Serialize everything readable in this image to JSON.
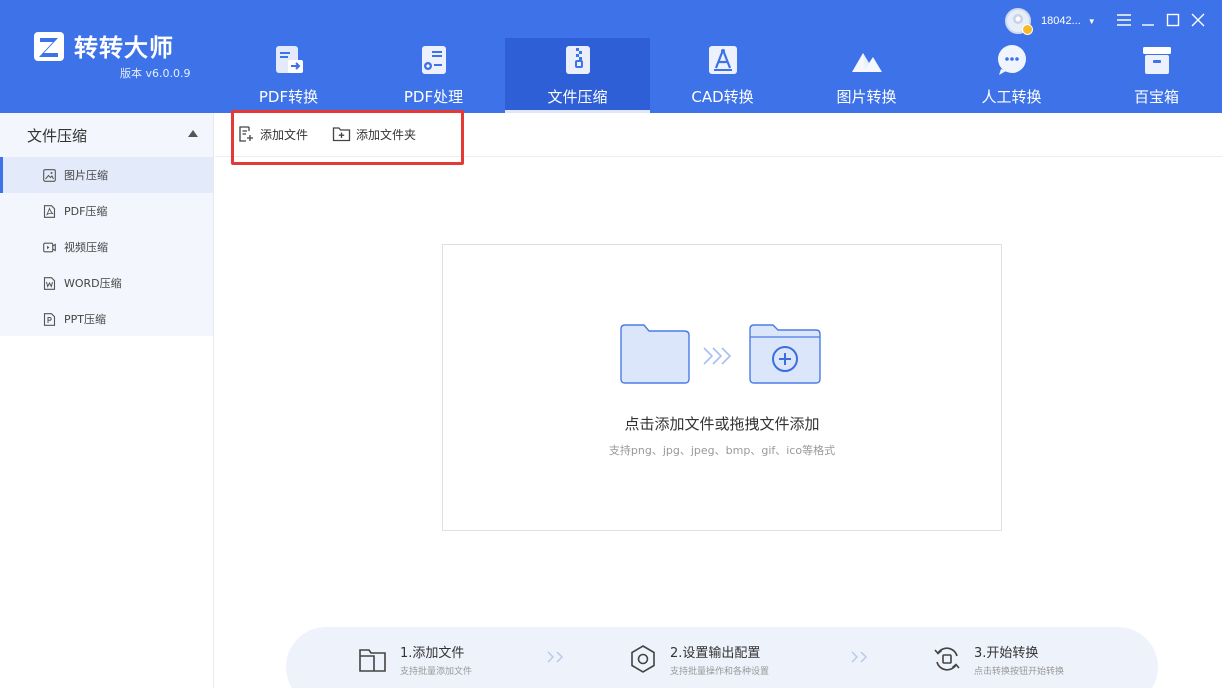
{
  "app": {
    "name": "转转大师",
    "version": "版本 v6.0.0.9",
    "accent_color": "#3d72e8",
    "logo_letter": "Z"
  },
  "user": {
    "name": "18042...",
    "avatar_icon": "user-avatar-icon"
  },
  "window_controls": [
    "menu-icon",
    "minimize-icon",
    "maximize-icon",
    "close-icon"
  ],
  "nav": {
    "tabs": [
      {
        "label": "PDF转换",
        "icon": "pdf-convert-icon",
        "active": false
      },
      {
        "label": "PDF处理",
        "icon": "pdf-process-icon",
        "active": false
      },
      {
        "label": "文件压缩",
        "icon": "file-compress-icon",
        "active": true
      },
      {
        "label": "CAD转换",
        "icon": "cad-icon",
        "active": false
      },
      {
        "label": "图片转换",
        "icon": "image-icon",
        "active": false
      },
      {
        "label": "人工转换",
        "icon": "chat-icon",
        "active": false
      },
      {
        "label": "百宝箱",
        "icon": "toolbox-icon",
        "active": false
      }
    ]
  },
  "sidebar": {
    "group_title": "文件压缩",
    "items": [
      {
        "label": "图片压缩",
        "icon": "image-file-icon",
        "active": true
      },
      {
        "label": "PDF压缩",
        "icon": "pdf-file-icon",
        "active": false
      },
      {
        "label": "视频压缩",
        "icon": "video-file-icon",
        "active": false
      },
      {
        "label": "WORD压缩",
        "icon": "word-file-icon",
        "active": false
      },
      {
        "label": "PPT压缩",
        "icon": "ppt-file-icon",
        "active": false
      }
    ]
  },
  "toolbar": {
    "add_file": "添加文件",
    "add_folder": "添加文件夹"
  },
  "dropzone": {
    "title": "点击添加文件或拖拽文件添加",
    "subtitle": "支持png、jpg、jpeg、bmp、gif、ico等格式"
  },
  "steps": [
    {
      "title": "1.添加文件",
      "desc": "支持批量添加文件",
      "icon": "folder-icon"
    },
    {
      "title": "2.设置输出配置",
      "desc": "支持批量操作和各种设置",
      "icon": "settings-icon"
    },
    {
      "title": "3.开始转换",
      "desc": "点击转换按钮开始转换",
      "icon": "convert-icon"
    }
  ]
}
